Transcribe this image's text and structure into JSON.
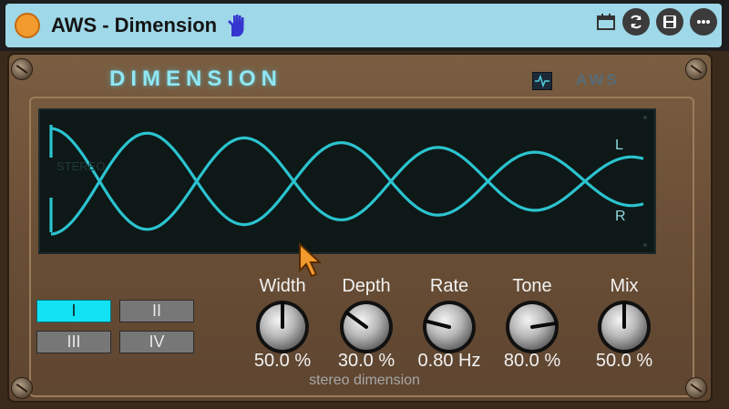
{
  "window": {
    "title": "AWS - Dimension",
    "icons": [
      "power-icon",
      "hand-icon",
      "calendar-icon",
      "sync-icon",
      "save-icon",
      "more-icon"
    ]
  },
  "plugin": {
    "brand": "DIMENSION",
    "logo": "AWS",
    "display": {
      "stereo_label": "STEREO",
      "left_label": "L",
      "right_label": "R"
    },
    "modes": [
      {
        "label": "I",
        "active": true
      },
      {
        "label": "II",
        "active": false
      },
      {
        "label": "III",
        "active": false
      },
      {
        "label": "IV",
        "active": false
      }
    ],
    "knobs": [
      {
        "label": "Width",
        "value": "50.0 %",
        "level": 0.5
      },
      {
        "label": "Depth",
        "value": "30.0 %",
        "level": 0.3
      },
      {
        "label": "Rate",
        "value": "0.80 Hz",
        "level": 0.22
      },
      {
        "label": "Tone",
        "value": "80.0 %",
        "level": 0.8
      },
      {
        "label": "Mix",
        "value": "50.0 %",
        "level": 0.5
      }
    ],
    "caption": "stereo dimension"
  },
  "colors": {
    "accent": "#13e2f5",
    "wave": "#2bc3cf",
    "titlebar": "#9fd8e8",
    "power": "#f39a2e",
    "hand": "#3a3ad0"
  }
}
